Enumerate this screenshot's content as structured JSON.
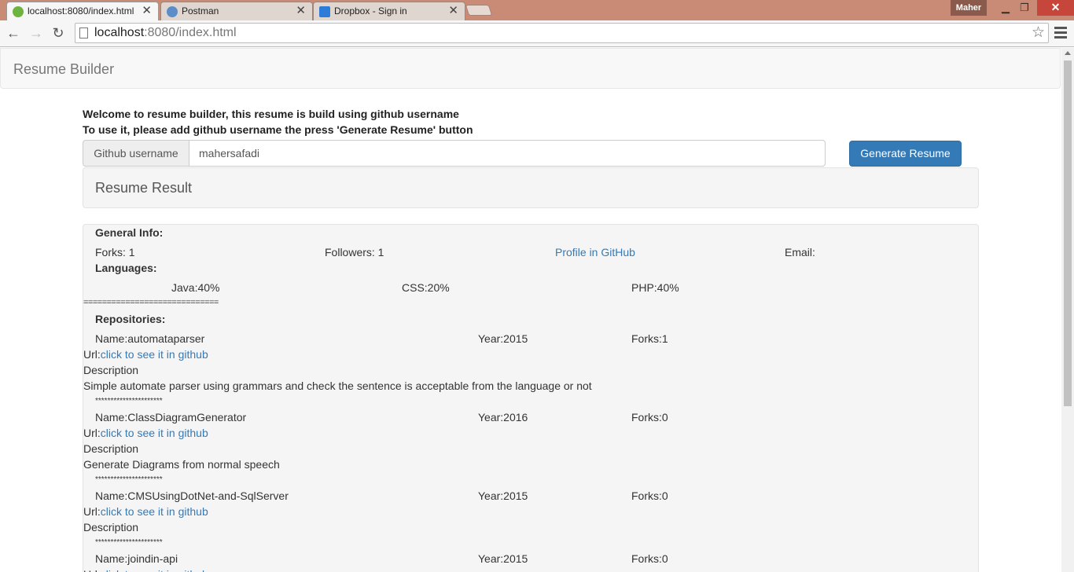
{
  "browser": {
    "tabs": [
      {
        "title": "localhost:8080/index.html",
        "active": true
      },
      {
        "title": "Postman",
        "active": false
      },
      {
        "title": "Dropbox - Sign in",
        "active": false
      }
    ],
    "user": "Maher",
    "url_host": "localhost",
    "url_rest": ":8080/index.html"
  },
  "app": {
    "brand": "Resume Builder",
    "intro_line1": "Welcome to resume builder, this resume is build using github username",
    "intro_line2": "To use it, please add github username the press 'Generate Resume' button",
    "addon_label": "Github username",
    "username_value": "mahersafadi",
    "generate_button": "Generate Resume",
    "result_title": "Resume Result"
  },
  "resume": {
    "general_heading": "General Info:",
    "forks": "Forks: 1",
    "followers": "Followers: 1",
    "profile_link": "Profile in GitHub",
    "email": "Email:",
    "languages_heading": "Languages:",
    "languages": [
      "Java:40%",
      "CSS:20%",
      "PHP:40%"
    ],
    "separator": "=============================",
    "repos_heading": "Repositories:",
    "url_prefix": "Url:",
    "url_link": "click to see it in github",
    "description_label": "Description",
    "stars": "**********************",
    "repos": [
      {
        "name": "Name:automataparser",
        "year": "Year:2015",
        "forks": "Forks:1",
        "description": "Simple automate parser using grammars and check the sentence is acceptable from the language or not"
      },
      {
        "name": "Name:ClassDiagramGenerator",
        "year": "Year:2016",
        "forks": "Forks:0",
        "description": "Generate Diagrams from normal speech"
      },
      {
        "name": "Name:CMSUsingDotNet-and-SqlServer",
        "year": "Year:2015",
        "forks": "Forks:0",
        "description": ""
      },
      {
        "name": "Name:joindin-api",
        "year": "Year:2015",
        "forks": "Forks:0",
        "description": ""
      }
    ]
  }
}
